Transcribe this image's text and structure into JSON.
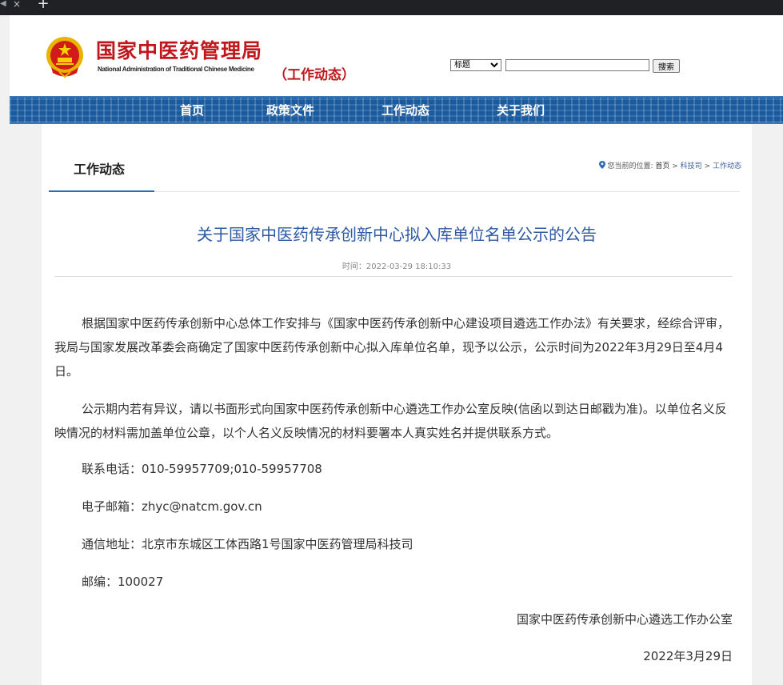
{
  "browser": {
    "close_glyph": "×",
    "new_tab_glyph": "+"
  },
  "site": {
    "name_cn": "国家中医药管理局",
    "name_en": "National Administration of Traditional Chinese Medicine",
    "section_tag": "（工作动态）",
    "brand_red": "#c0171d",
    "nav_blue": "#1a5a9e"
  },
  "search": {
    "select_value": "标题",
    "input_value": "",
    "button_label": "搜索"
  },
  "nav": [
    {
      "label": "首页"
    },
    {
      "label": "政策文件"
    },
    {
      "label": "工作动态"
    },
    {
      "label": "关于我们"
    }
  ],
  "subnav": {
    "active_tab": "工作动态"
  },
  "breadcrumb": {
    "icon": "location-pin-icon",
    "prefix": "您当前的位置:",
    "home": "首页",
    "sep": ">",
    "level1": "科技司",
    "level2": "工作动态"
  },
  "article": {
    "title": "关于国家中医药传承创新中心拟入库单位名单公示的公告",
    "time": "时间：2022-03-29 18:10:33",
    "paragraph1": "根据国家中医药传承创新中心总体工作安排与《国家中医药传承创新中心建设项目遴选工作办法》有关要求，经综合评审，我局与国家发展改革委会商确定了国家中医药传承创新中心拟入库单位名单，现予以公示，公示时间为2022年3月29日至4月4日。",
    "paragraph2": "公示期内若有异议，请以书面形式向国家中医药传承创新中心遴选工作办公室反映(信函以到达日邮戳为准)。以单位名义反映情况的材料需加盖单位公章，以个人名义反映情况的材料要署本人真实姓名并提供联系方式。",
    "phone": "联系电话：010-59957709;010-59957708",
    "email": "电子邮箱：zhyc@natcm.gov.cn",
    "address": "通信地址：北京市东城区工体西路1号国家中医药管理局科技司",
    "postcode": "邮编：100027",
    "signature": "国家中医药传承创新中心遴选工作办公室",
    "date": "2022年3月29日"
  }
}
